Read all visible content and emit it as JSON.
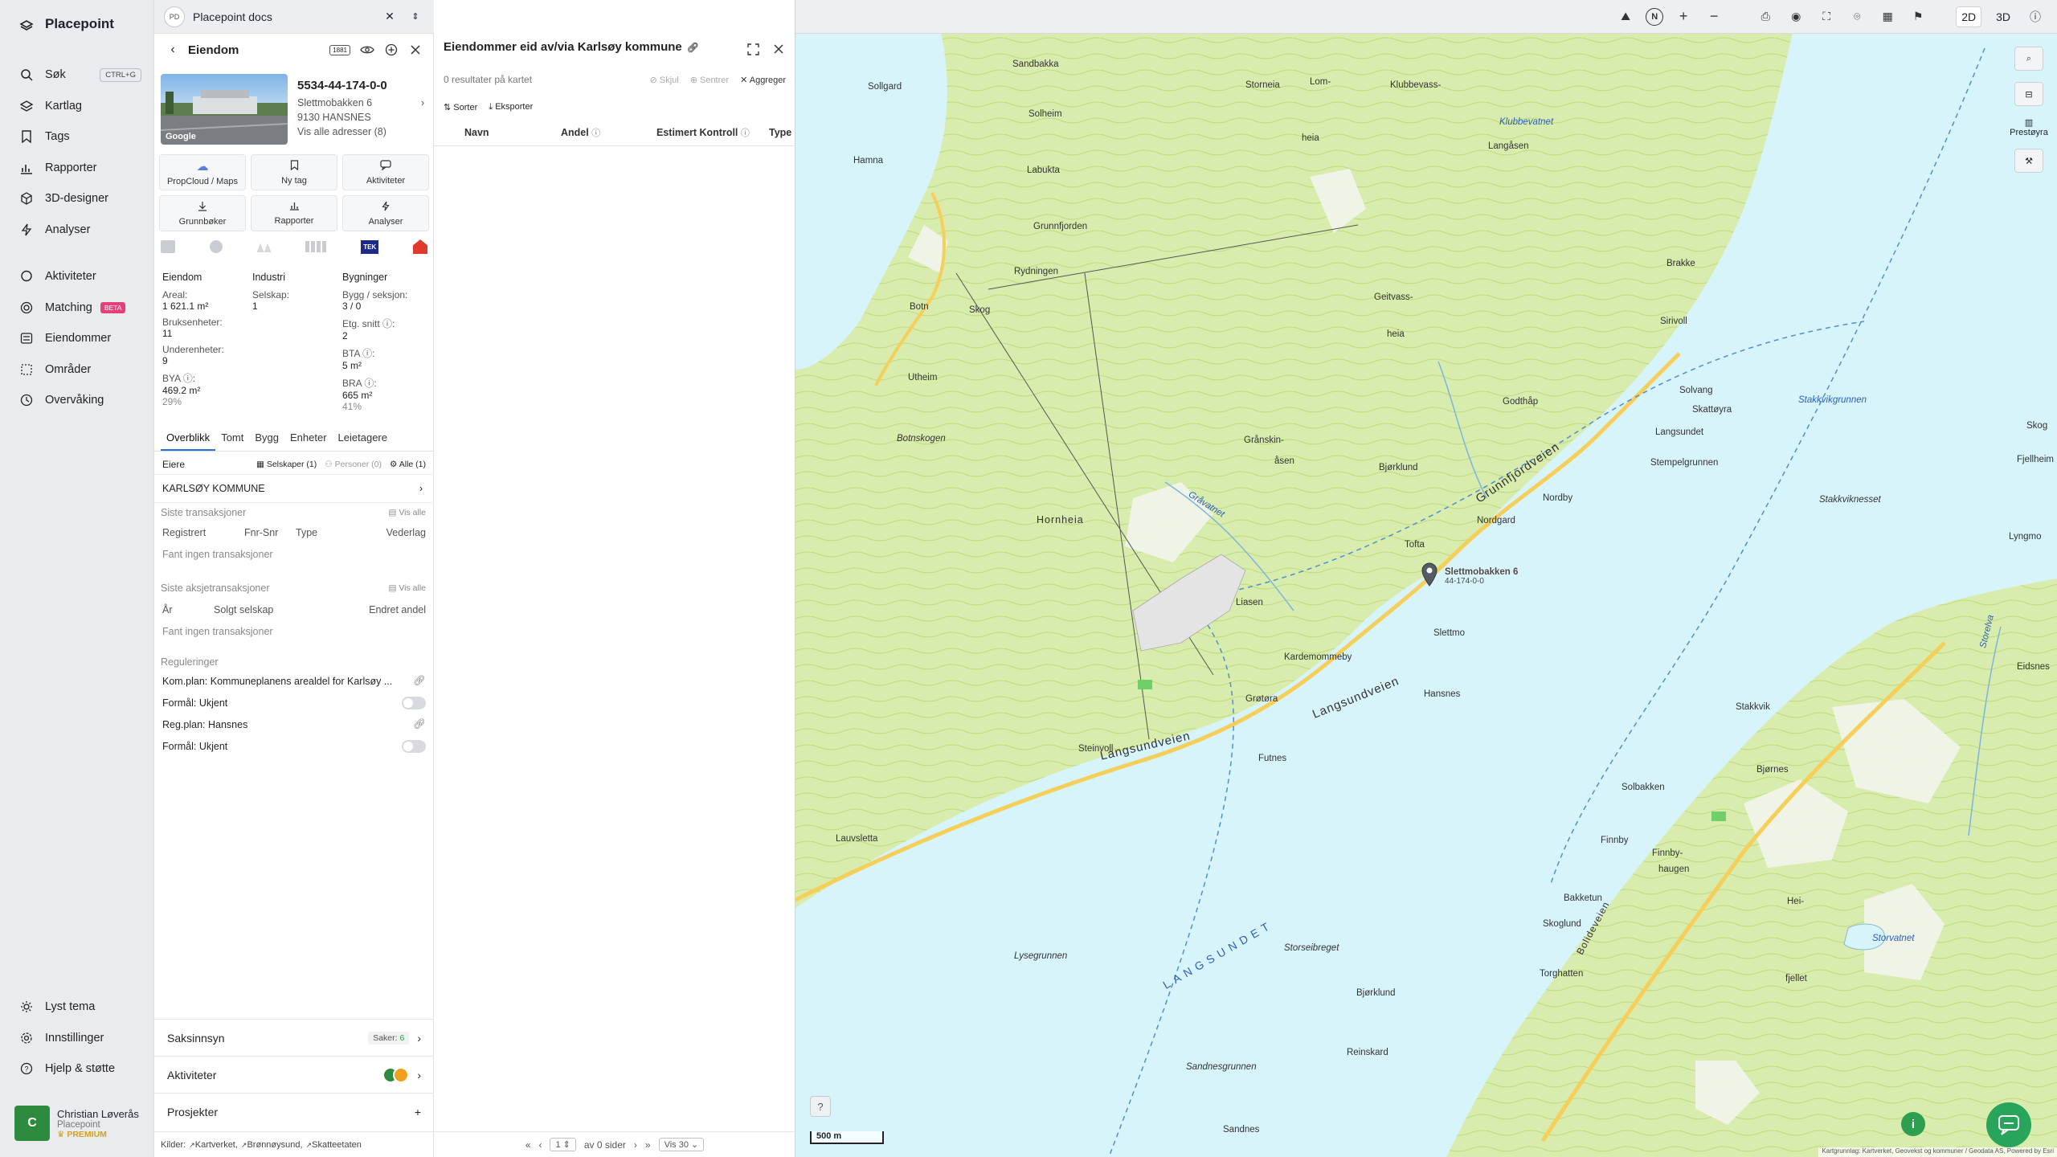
{
  "nav": {
    "brand": "Placepoint",
    "items": [
      {
        "label": "Søk",
        "icon": "search-icon",
        "kbd": "CTRL+G"
      },
      {
        "label": "Kartlag",
        "icon": "layers-icon"
      },
      {
        "label": "Tags",
        "icon": "bookmark-icon"
      },
      {
        "label": "Rapporter",
        "icon": "chart-icon"
      },
      {
        "label": "3D-designer",
        "icon": "cube-icon"
      },
      {
        "label": "Analyser",
        "icon": "bolt-icon"
      },
      {
        "label": "Aktiviteter",
        "icon": "chat-icon"
      },
      {
        "label": "Matching",
        "icon": "target-icon",
        "badge": "BETA"
      },
      {
        "label": "Eiendommer",
        "icon": "list-icon"
      },
      {
        "label": "Områder",
        "icon": "area-icon"
      },
      {
        "label": "Overvåking",
        "icon": "monitor-icon"
      }
    ],
    "bottom": [
      {
        "label": "Lyst tema",
        "icon": "sun-icon"
      },
      {
        "label": "Innstillinger",
        "icon": "gear-icon"
      },
      {
        "label": "Hjelp & støtte",
        "icon": "help-icon"
      }
    ],
    "user": {
      "initial": "C",
      "name": "Christian Løverås",
      "org": "Placepoint",
      "tier": "PREMIUM"
    }
  },
  "docs": {
    "badge": "PD",
    "title": "Placepoint docs"
  },
  "property": {
    "header": "Eiendom",
    "header_badge": "1881",
    "id": "5534-44-174-0-0",
    "address": "Slettmobakken 6",
    "postal": "9130 HANSNES",
    "all_addresses": "Vis alle adresser (8)",
    "image_brand": "Google",
    "actions": [
      {
        "label": "PropCloud / Maps",
        "icon": "cloud-icon"
      },
      {
        "label": "Ny tag",
        "icon": "bookmark-icon"
      },
      {
        "label": "Aktiviteter",
        "icon": "chat-icon"
      },
      {
        "label": "Grunnbøker",
        "icon": "download-icon"
      },
      {
        "label": "Rapporter",
        "icon": "chart-icon"
      },
      {
        "label": "Analyser",
        "icon": "bolt-icon"
      }
    ],
    "tek_badge": "TEK",
    "stats": {
      "col1_head": "Eiendom",
      "col2_head": "Industri",
      "col3_head": "Bygninger",
      "areal_label": "Areal:",
      "areal": "1 621.1 m²",
      "selskap_label": "Selskap:",
      "selskap": "1",
      "bygg_label": "Bygg / seksjon:",
      "bygg": "3 / 0",
      "bruks_label": "Bruksenheter:",
      "bruks": "11",
      "etg_label": "Etg. snitt ⓘ:",
      "etg": "2",
      "under_label": "Underenheter:",
      "under": "9",
      "bta_label": "BTA ⓘ:",
      "bta": "5 m²",
      "bya_label": "BYA ⓘ:",
      "bya": "469.2 m²",
      "bya_pct": "29%",
      "bra_label": "BRA ⓘ:",
      "bra": "665 m²",
      "bra_pct": "41%"
    },
    "tabs": [
      "Overblikk",
      "Tomt",
      "Bygg",
      "Enheter",
      "Leietagere"
    ],
    "owners": {
      "label": "Eiere",
      "companies": "Selskaper (1)",
      "persons": "Personer (0)",
      "all": "Alle (1)",
      "owner": "KARLSØY KOMMUNE"
    },
    "transactions": {
      "label": "Siste transaksjoner",
      "show_all": "Vis alle",
      "cols": [
        "Registrert",
        "Fnr-Snr",
        "Type",
        "Vederlag"
      ],
      "empty": "Fant ingen transaksjoner"
    },
    "share_tx": {
      "label": "Siste aksjetransaksjoner",
      "show_all": "Vis alle",
      "cols": [
        "År",
        "Solgt selskap",
        "Endret andel"
      ],
      "empty": "Fant ingen transaksjoner"
    },
    "regulations": {
      "label": "Reguleringer",
      "items": [
        {
          "text": "Kom.plan: Kommuneplanens arealdel for Karlsøy ...",
          "kind": "link"
        },
        {
          "text": "Formål: Ukjent",
          "kind": "toggle"
        },
        {
          "text": "Reg.plan: Hansnes",
          "kind": "link"
        },
        {
          "text": "Formål: Ukjent",
          "kind": "toggle"
        }
      ]
    },
    "accordions": {
      "saksinnsyn": "Saksinnsyn",
      "saker_label": "Saker:",
      "saker": "6",
      "aktiviteter": "Aktiviteter",
      "prosjekter": "Prosjekter"
    },
    "sources": {
      "label": "Kilder:",
      "items": [
        "Kartverket,",
        "Brønnøysund,",
        "Skatteetaten"
      ]
    }
  },
  "owned": {
    "title": "Eiendommer eid av/via Karlsøy kommune",
    "results": "0 resultater på kartet",
    "hide": "Skjul",
    "center": "Sentrer",
    "aggregate": "Aggreger",
    "sort": "Sorter",
    "export": "Eksporter",
    "columns": [
      "Navn",
      "Andel",
      "Estimert Kontroll",
      "Type"
    ],
    "pager": {
      "page": "1",
      "of": "av 0 sider",
      "per": "Vis 30"
    }
  },
  "map": {
    "modes": [
      "2D",
      "3D"
    ],
    "right_label": "Prestøyra",
    "scale": "500 m",
    "attribution": "Kartgrunnlag: Kartverket, Geovekst og kommuner / Geodata AS, Powered by Esri",
    "marker_label": "Slettmobakken 6",
    "marker_id": "44-174-0-0",
    "places": [
      "Sandbakka",
      "Storneia",
      "Lom-",
      "Klubbevass-",
      "Sollgard",
      "Solheim",
      "heia",
      "Hamna",
      "Labukta",
      "Langåsen",
      "Grunnfjorden",
      "Rydningen",
      "Geitvass-",
      "heia",
      "Brakke",
      "Botn",
      "Skog",
      "Sirivoll",
      "Utheim",
      "Solvang",
      "Skattøyra",
      "Godthåp",
      "Langsundet",
      "Stempelgrunnen",
      "Fjellheim",
      "Botnskogen",
      "Grånskin-",
      "åsen",
      "Bjørklund",
      "Skog",
      "Nordby",
      "Nordgard",
      "Stakkviknesset",
      "Lyngmo",
      "Hornheia",
      "Tofta",
      "Liasen",
      "Slettmo",
      "Kardemommeby",
      "Hansnes",
      "Grøtøra",
      "Steinvoll",
      "Futnes",
      "Eidsnes",
      "Stakkvik",
      "Bjørnes",
      "Solbakken",
      "Finnby",
      "Finnby-",
      "haugen",
      "Lauvsletta",
      "Bakketun",
      "Skoglund",
      "Hei-",
      "fjellet",
      "Torghatten",
      "Storseibreget",
      "Lysegrunnen",
      "Bjørklund",
      "Reinskard",
      "Sandnesgrunnen",
      "Sandnes"
    ],
    "water": [
      "Klubbevatnet",
      "Gråvatnet",
      "Stakkvikgrunnen",
      "Storvatnet",
      "Storelva"
    ],
    "roads": [
      "Grunnfjordveien",
      "Langsundveien",
      "Langsundveien",
      "Bolideveien"
    ],
    "sound_label": "LANGSUNDET",
    "help": "?"
  }
}
